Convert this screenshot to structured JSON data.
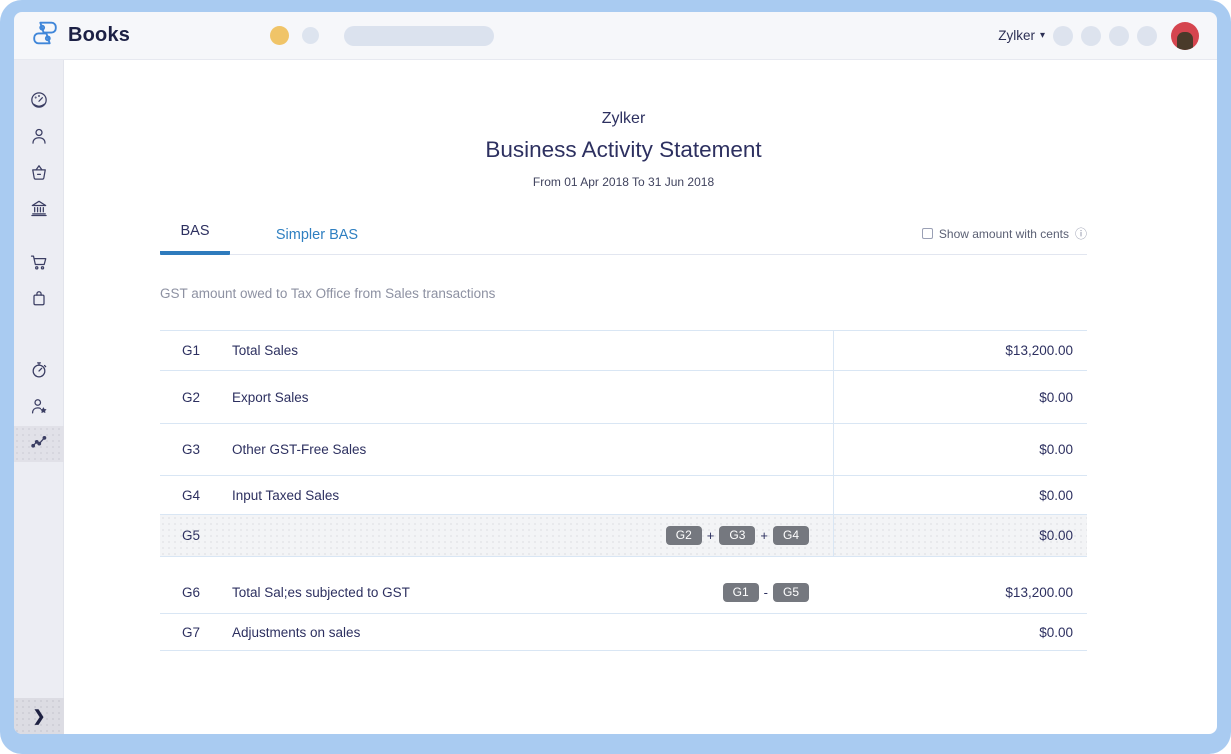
{
  "topbar": {
    "brand": "Books",
    "org_selector_label": "Zylker",
    "caret": "▾"
  },
  "sidebar": {
    "items": [
      {
        "icon": "dashboard-icon"
      },
      {
        "icon": "contacts-icon"
      },
      {
        "icon": "items-icon"
      },
      {
        "icon": "banking-icon"
      },
      {
        "icon": "sales-icon"
      },
      {
        "icon": "purchases-icon"
      },
      {
        "icon": "time-tracking-icon"
      },
      {
        "icon": "accountant-icon"
      },
      {
        "icon": "reports-icon",
        "active": true
      }
    ],
    "collapse_glyph": "❯"
  },
  "report": {
    "org": "Zylker",
    "title": "Business Activity Statement",
    "date_range": "From 01 Apr 2018 To 31 Jun 2018",
    "tabs": [
      {
        "label": "BAS",
        "active": true
      },
      {
        "label": "Simpler BAS",
        "active": false
      }
    ],
    "show_cents_label": "Show amount with cents",
    "info_icon": "ⓘ",
    "section_heading": "GST amount owed to Tax Office from Sales transactions",
    "table": {
      "rows": [
        {
          "section": 1,
          "code": "G1",
          "label": "Total Sales",
          "amount": "$13,200.00"
        },
        {
          "section": 1,
          "code": "G2",
          "label": "Export Sales",
          "amount": "$0.00"
        },
        {
          "section": 1,
          "code": "G3",
          "label": "Other GST-Free Sales",
          "amount": "$0.00"
        },
        {
          "section": 1,
          "code": "G4",
          "label": "Input Taxed Sales",
          "amount": "$0.00"
        },
        {
          "section": 1,
          "code": "G5",
          "label": "",
          "formula": [
            "G2",
            "+",
            "G3",
            "+",
            "G4"
          ],
          "amount": "$0.00",
          "highlighted": true
        },
        {
          "section": 2,
          "code": "G6",
          "label": "Total Sal;es subjected to GST",
          "formula": [
            "G1",
            "-",
            "G5"
          ],
          "amount": "$13,200.00"
        },
        {
          "section": 2,
          "code": "G7",
          "label": "Adjustments on sales",
          "amount": "$0.00"
        }
      ]
    }
  },
  "colors": {
    "frame_blue": "#a9cbf1",
    "accent_blue": "#2e7bbd",
    "chip_gray": "#75787f",
    "highlight_row": "#f3f4f6",
    "dot_yellow": "#f0c468",
    "avatar_red": "#d5454f",
    "text_navy": "#2d3060"
  }
}
